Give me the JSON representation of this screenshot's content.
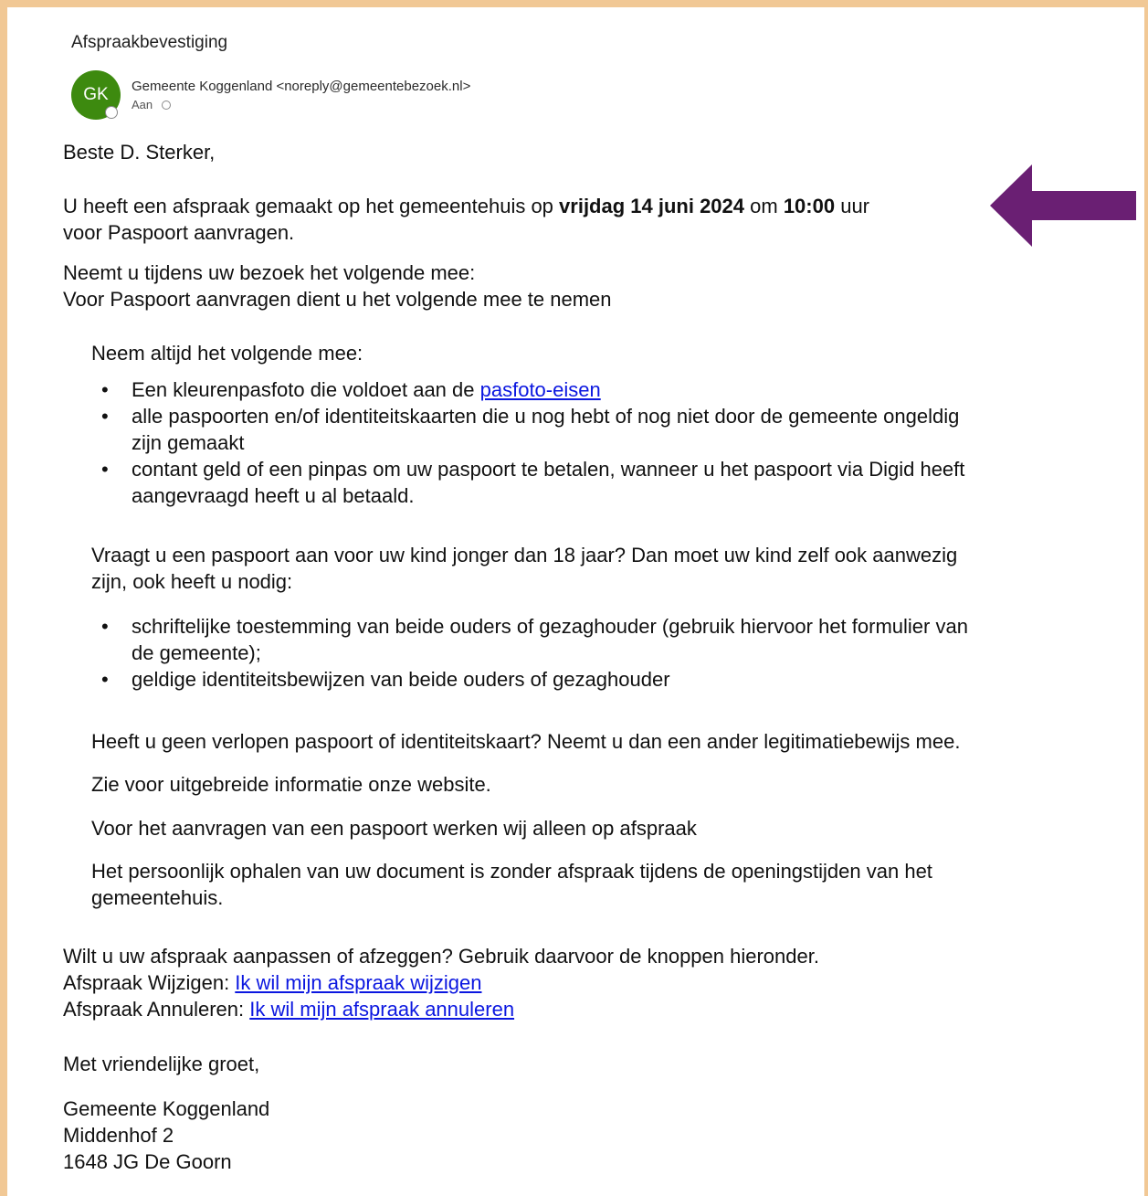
{
  "colors": {
    "frame_border": "#f1c895",
    "avatar_bg": "#3d8a0f",
    "link": "#0b17e0",
    "arrow": "#6a1f73"
  },
  "email": {
    "subject": "Afspraakbevestiging",
    "sender": {
      "initials": "GK",
      "display": "Gemeente Koggenland <noreply@gemeentebezoek.nl>"
    },
    "recipients_label": "Aan"
  },
  "body": {
    "greeting": "Beste D. Sterker,",
    "appointment": {
      "prefix": "U heeft een afspraak gemaakt op het gemeentehuis op ",
      "date": "vrijdag 14 juni 2024",
      "mid": " om ",
      "time": "10:00",
      "suffix": " uur",
      "line2": "voor Paspoort aanvragen."
    },
    "bring_intro_1": "Neemt u tijdens uw bezoek het volgende mee:",
    "bring_intro_2": "Voor Paspoort aanvragen dient u het volgende mee te nemen",
    "always_heading": "Neem altijd het volgende mee:",
    "always_items": {
      "photo_prefix": "Een kleurenpasfoto die voldoet aan de ",
      "photo_link": "pasfoto-eisen",
      "passports_line1": "alle paspoorten en/of identiteitskaarten die u nog hebt of nog niet door de gemeente ongeldig",
      "passports_line2": "zijn gemaakt",
      "payment_line1": "contant geld of een pinpas om uw paspoort te betalen, wanneer u het paspoort via Digid heeft",
      "payment_line2": "aangevraagd heeft u al betaald."
    },
    "child_intro_line1": "Vraagt u een paspoort aan voor uw kind jonger dan 18 jaar? Dan moet uw kind zelf ook aanwezig",
    "child_intro_line2": "zijn, ook heeft u nodig:",
    "child_items": {
      "consent_line1": "schriftelijke toestemming van beide ouders of gezaghouder  (gebruik hiervoor het formulier van",
      "consent_line2": "de gemeente);",
      "ids": "geldige identiteitsbewijzen van beide ouders of gezaghouder"
    },
    "no_expired": "Heeft u geen verlopen paspoort of identiteitskaart? Neemt u dan een ander legitimatiebewijs mee.",
    "website_info": "Zie voor uitgebreide informatie onze website.",
    "appointment_only": "Voor het aanvragen van een  paspoort werken wij alleen op afspraak",
    "pickup_line1": "Het persoonlijk ophalen van uw document is zonder afspraak tijdens de openingstijden van het",
    "pickup_line2": "gemeentehuis.",
    "change_intro": "Wilt u uw afspraak aanpassen of afzeggen? Gebruik daarvoor de knoppen hieronder.",
    "change_label": "Afspraak Wijzigen: ",
    "change_link": "Ik wil mijn afspraak wijzigen",
    "cancel_label": "Afspraak Annuleren: ",
    "cancel_link": "Ik wil mijn afspraak annuleren",
    "closing": "Met vriendelijke groet,",
    "signature": {
      "name": "Gemeente Koggenland",
      "street": "Middenhof 2",
      "city": "1648 JG  De Goorn"
    }
  },
  "annotation": {
    "arrow_icon": "left-arrow-icon"
  }
}
